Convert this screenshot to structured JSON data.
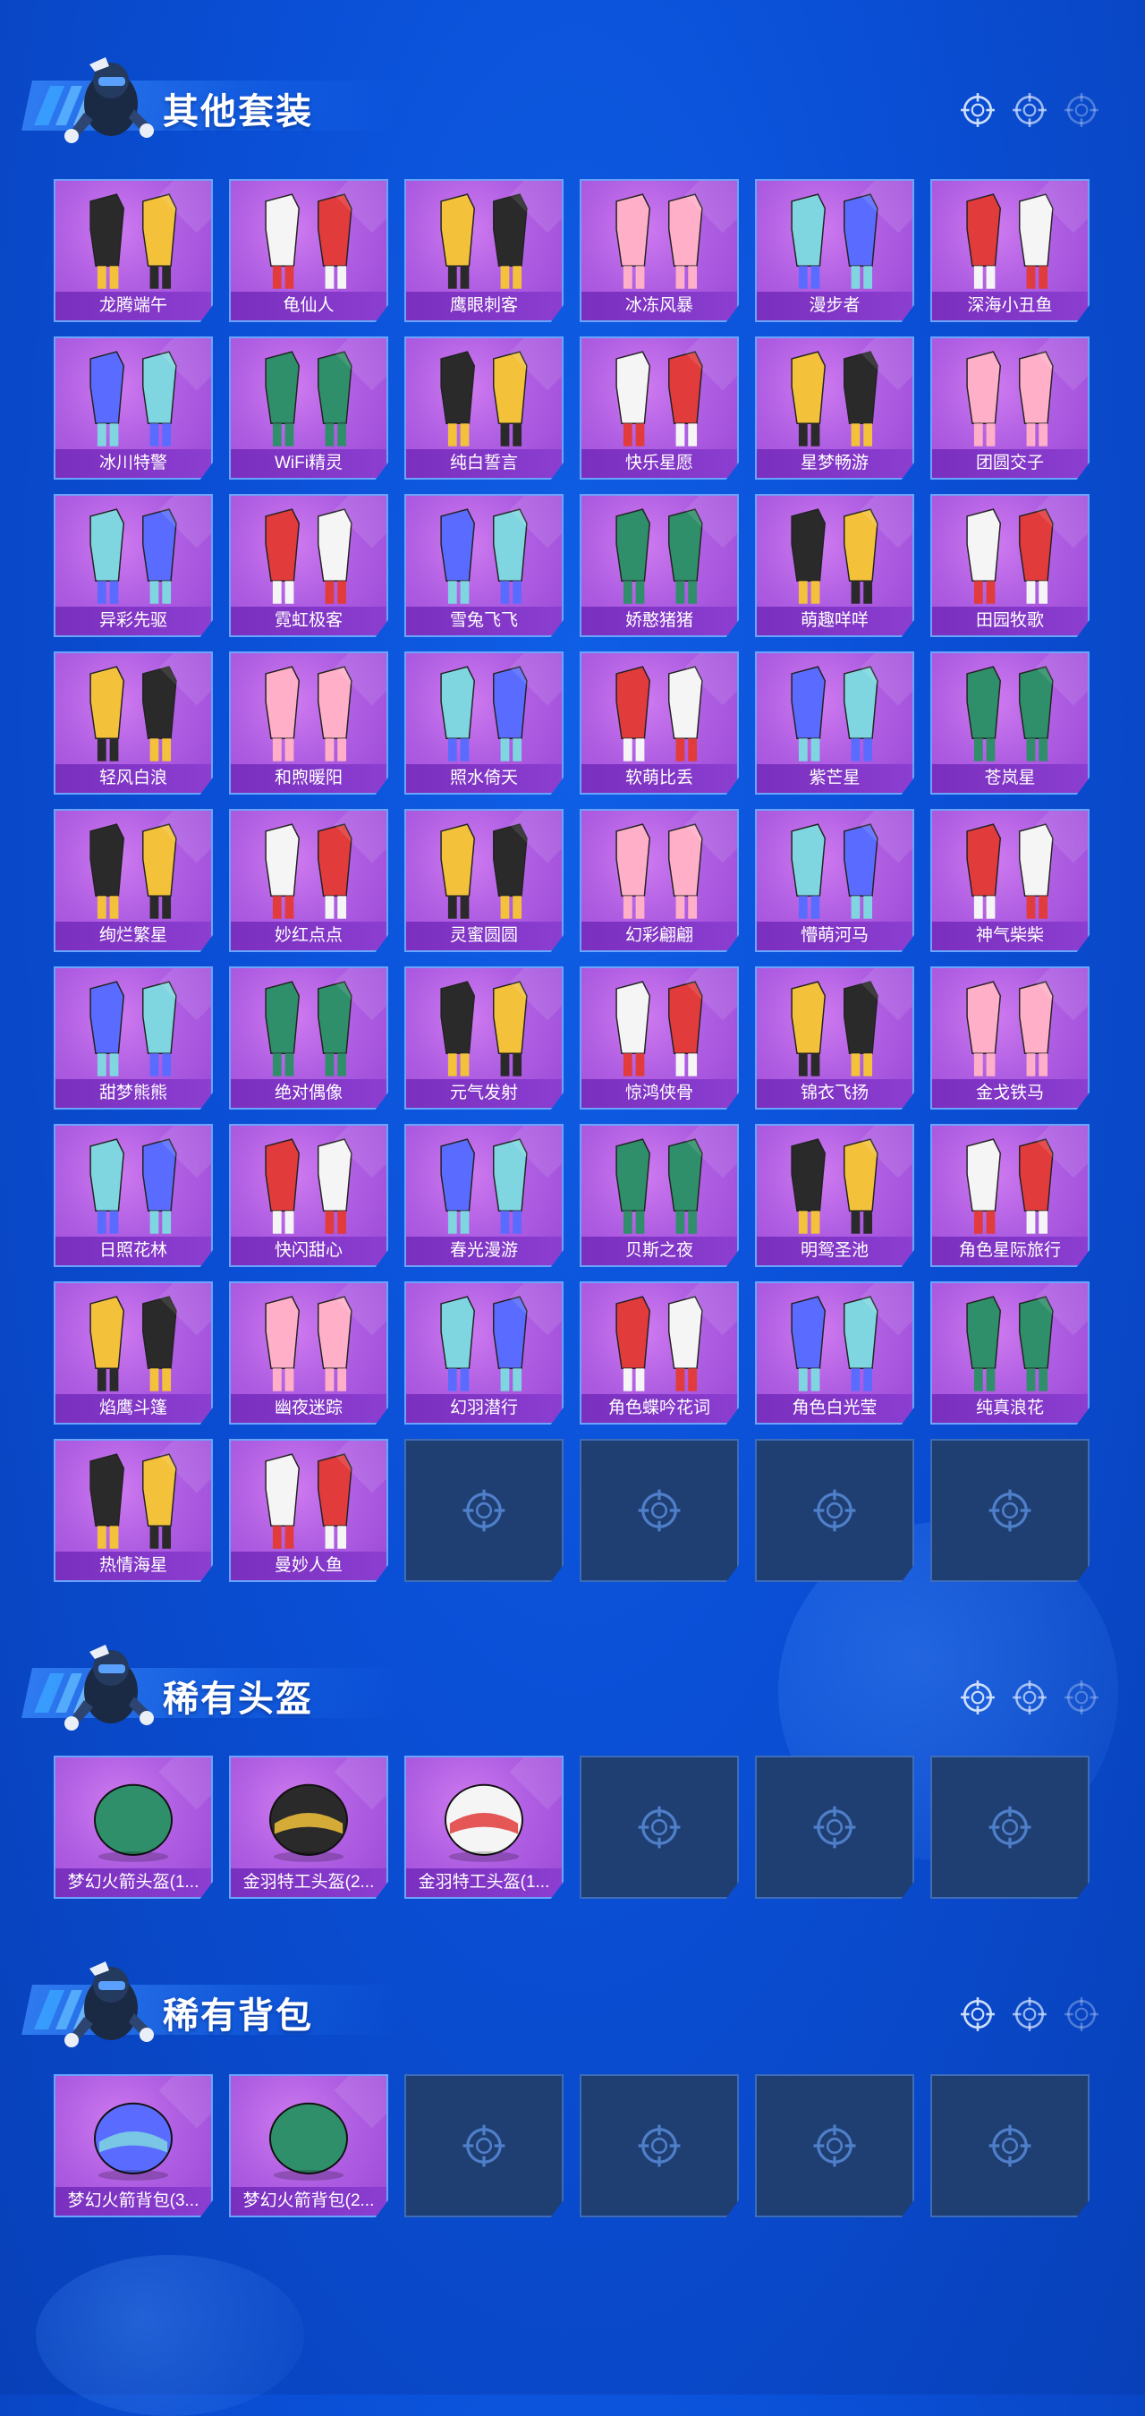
{
  "sections": [
    {
      "title": "其他套装",
      "items": [
        "龙腾端午",
        "龟仙人",
        "鹰眼刺客",
        "冰冻风暴",
        "漫步者",
        "深海小丑鱼",
        "冰川特警",
        "WiFi精灵",
        "纯白誓言",
        "快乐星愿",
        "星梦畅游",
        "团圆交子",
        "异彩先驱",
        "霓虹极客",
        "雪兔飞飞",
        "娇憨猪猪",
        "萌趣咩咩",
        "田园牧歌",
        "轻风白浪",
        "和煦暖阳",
        "照水倚天",
        "软萌比丢",
        "紫芒星",
        "苍岚星",
        "绚烂繁星",
        "妙红点点",
        "灵蜜圆圆",
        "幻彩翩翩",
        "懵萌河马",
        "神气柴柴",
        "甜梦熊熊",
        "绝对偶像",
        "元气发射",
        "惊鸿侠骨",
        "锦衣飞扬",
        "金戈铁马",
        "日照花林",
        "快闪甜心",
        "春光漫游",
        "贝斯之夜",
        "明鸳圣池",
        "角色星际旅行",
        "焰鹰斗篷",
        "幽夜迷踪",
        "幻羽潜行",
        "角色蝶吟花词",
        "角色白光莹",
        "纯真浪花",
        "热情海星",
        "曼妙人鱼"
      ],
      "empty_slots": 4
    },
    {
      "title": "稀有头盔",
      "items": [
        "梦幻火箭头盔(1...",
        "金羽特工头盔(2...",
        "金羽特工头盔(1..."
      ],
      "empty_slots": 3
    },
    {
      "title": "稀有背包",
      "items": [
        "梦幻火箭背包(3...",
        "梦幻火箭背包(2..."
      ],
      "empty_slots": 4
    }
  ],
  "icons": {
    "header_dot": "crosshair-icon",
    "empty_slot": "crosshair-icon",
    "mascot": "soldier-mascot-icon"
  },
  "colors": {
    "background": "#0a4fd6",
    "card_purple": "#b05fe3",
    "label_purple": "#8b3ed0",
    "empty_slot": "#1f3f73"
  }
}
